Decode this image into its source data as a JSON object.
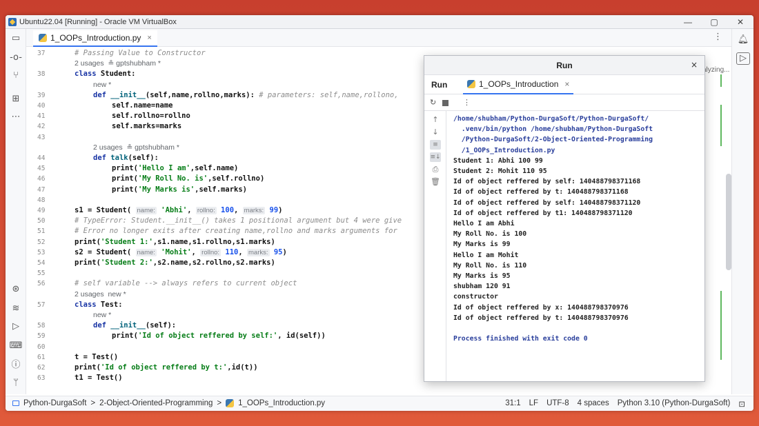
{
  "window": {
    "title": "Ubuntu22.04 [Running] - Oracle VM VirtualBox",
    "min": "—",
    "max": "▢",
    "close": "✕"
  },
  "tab": {
    "name": "1_OOPs_Introduction.py",
    "close": "×"
  },
  "analyzing": "alyzing...",
  "editor": {
    "lines": [
      {
        "n": "37",
        "type": "c",
        "text": "# Passing Value to Constructor"
      },
      {
        "n": "",
        "type": "hint",
        "text": "2 usages  ≗ gptshubham *"
      },
      {
        "n": "38",
        "type": "code",
        "html": "<span class='kw'>class</span> Student:"
      },
      {
        "n": "",
        "type": "hint",
        "indent": 1,
        "text": "new *"
      },
      {
        "n": "39",
        "type": "code",
        "indent": 1,
        "html": "<span class='kw'>def</span> <span class='fn'>__init__</span>(self,name,rollno,marks): <span style='color:#8c8c8c;font-style:italic;font-weight:normal'># parameters: self,name,rollono,</span>"
      },
      {
        "n": "40",
        "type": "code",
        "indent": 2,
        "html": "self.name=name"
      },
      {
        "n": "41",
        "type": "code",
        "indent": 2,
        "html": "self.rollno=rollno"
      },
      {
        "n": "42",
        "type": "code",
        "indent": 2,
        "html": "self.marks=marks"
      },
      {
        "n": "43",
        "type": "code",
        "html": ""
      },
      {
        "n": "",
        "type": "hint",
        "indent": 1,
        "text": "2 usages  ≗ gptshubham *"
      },
      {
        "n": "44",
        "type": "code",
        "indent": 1,
        "html": "<span class='kw'>def</span> <span class='fn'>talk</span>(self):"
      },
      {
        "n": "45",
        "type": "code",
        "indent": 2,
        "html": "print(<span class='str'>'Hello I am'</span>,self.name)"
      },
      {
        "n": "46",
        "type": "code",
        "indent": 2,
        "html": "print(<span class='str'>'My Roll No. is'</span>,self.rollno)"
      },
      {
        "n": "47",
        "type": "code",
        "indent": 2,
        "html": "print(<span class='str'>'My Marks is'</span>,self.marks)"
      },
      {
        "n": "48",
        "type": "code",
        "html": ""
      },
      {
        "n": "49",
        "type": "code",
        "html": "s1 = Student( <span class='inlay'>name:</span> <span class='str'>'Abhi'</span>, <span class='inlay'>rollno:</span> <span class='num'>100</span>, <span class='inlay'>marks:</span> <span class='num'>99</span>)"
      },
      {
        "n": "50",
        "type": "c",
        "text": "# TypeError: Student.__init__() takes 1 positional argument but 4 were give"
      },
      {
        "n": "51",
        "type": "c",
        "text": "# Error no longer exits after creating name,rollno and marks arguments for"
      },
      {
        "n": "52",
        "type": "code",
        "html": "print(<span class='str'>'Student 1:'</span>,s1.name,s1.rollno,s1.marks)"
      },
      {
        "n": "53",
        "type": "code",
        "html": "s2 = Student( <span class='inlay'>name:</span> <span class='str'>'Mohit'</span>, <span class='inlay'>rollno:</span> <span class='num'>110</span>, <span class='inlay'>marks:</span> <span class='num'>95</span>)"
      },
      {
        "n": "54",
        "type": "code",
        "html": "print(<span class='str'>'Student 2:'</span>,s2.name,s2.rollno,s2.marks)"
      },
      {
        "n": "55",
        "type": "code",
        "html": ""
      },
      {
        "n": "56",
        "type": "c",
        "text": "# self variable --> always refers to current object"
      },
      {
        "n": "",
        "type": "hint",
        "text": "2 usages  new *"
      },
      {
        "n": "57",
        "type": "code",
        "html": "<span class='kw'>class</span> Test:"
      },
      {
        "n": "",
        "type": "hint",
        "indent": 1,
        "text": "new *"
      },
      {
        "n": "58",
        "type": "code",
        "indent": 1,
        "html": "<span class='kw'>def</span> <span class='fn'>__init__</span>(self):"
      },
      {
        "n": "59",
        "type": "code",
        "indent": 2,
        "html": "print(<span class='str'>'Id of object reffered by self:'</span>, id(self))"
      },
      {
        "n": "60",
        "type": "code",
        "html": ""
      },
      {
        "n": "61",
        "type": "code",
        "html": "t = Test()"
      },
      {
        "n": "62",
        "type": "code",
        "html": "print(<span class='str'>'Id of object reffered by t:'</span>,id(t))"
      },
      {
        "n": "63",
        "type": "code",
        "html": "t1 = Test()"
      }
    ]
  },
  "run": {
    "title": "Run",
    "label": "Run",
    "tab": "1_OOPs_Introduction",
    "tab_close": "×",
    "close": "×",
    "output": [
      {
        "cls": "path",
        "text": "/home/shubham/Python-DurgaSoft/Python-DurgaSoft/"
      },
      {
        "cls": "path",
        "text": "  .venv/bin/python /home/shubham/Python-DurgaSoft"
      },
      {
        "cls": "path",
        "text": "  /Python-DurgaSoft/2-Object-Oriented-Programming"
      },
      {
        "cls": "path",
        "text": "  /1_OOPs_Introduction.py"
      },
      {
        "cls": "",
        "text": "Student 1: Abhi 100 99"
      },
      {
        "cls": "",
        "text": "Student 2: Mohit 110 95"
      },
      {
        "cls": "",
        "text": "Id of object reffered by self: 140488798371168"
      },
      {
        "cls": "",
        "text": "Id of object reffered by t: 140488798371168"
      },
      {
        "cls": "",
        "text": "Id of object reffered by self: 140488798371120"
      },
      {
        "cls": "",
        "text": "Id of object reffered by t1: 140488798371120"
      },
      {
        "cls": "",
        "text": "Hello I am Abhi"
      },
      {
        "cls": "",
        "text": "My Roll No. is 100"
      },
      {
        "cls": "",
        "text": "My Marks is 99"
      },
      {
        "cls": "",
        "text": "Hello I am Mohit"
      },
      {
        "cls": "",
        "text": "My Roll No. is 110"
      },
      {
        "cls": "",
        "text": "My Marks is 95"
      },
      {
        "cls": "",
        "text": "shubham 120 91"
      },
      {
        "cls": "",
        "text": "constructor"
      },
      {
        "cls": "",
        "text": "Id of object reffered by x: 140488798370976"
      },
      {
        "cls": "",
        "text": "Id of object reffered by t: 140488798370976"
      },
      {
        "cls": "",
        "text": ""
      },
      {
        "cls": "fin",
        "text": "Process finished with exit code 0"
      }
    ]
  },
  "status": {
    "crumbs": [
      "Python-DurgaSoft",
      "2-Object-Oriented-Programming",
      "1_OOPs_Introduction.py"
    ],
    "sep": ">",
    "position": "31:1",
    "line_ending": "LF",
    "encoding": "UTF-8",
    "indent": "4 spaces",
    "interpreter": "Python 3.10 (Python-DurgaSoft)"
  },
  "icons": {
    "left": [
      "folder-icon",
      "commit-icon",
      "branches-icon",
      "structure-icon",
      "more-icon",
      "python-console-icon",
      "layers-icon",
      "run-icon",
      "terminal-icon",
      "problems-icon",
      "git-icon"
    ],
    "right": [
      "bell-icon",
      "play-icon"
    ]
  },
  "colors": {
    "accent": "#3574f0",
    "keyword": "#1733a4",
    "string": "#067d17",
    "number": "#1750eb"
  }
}
